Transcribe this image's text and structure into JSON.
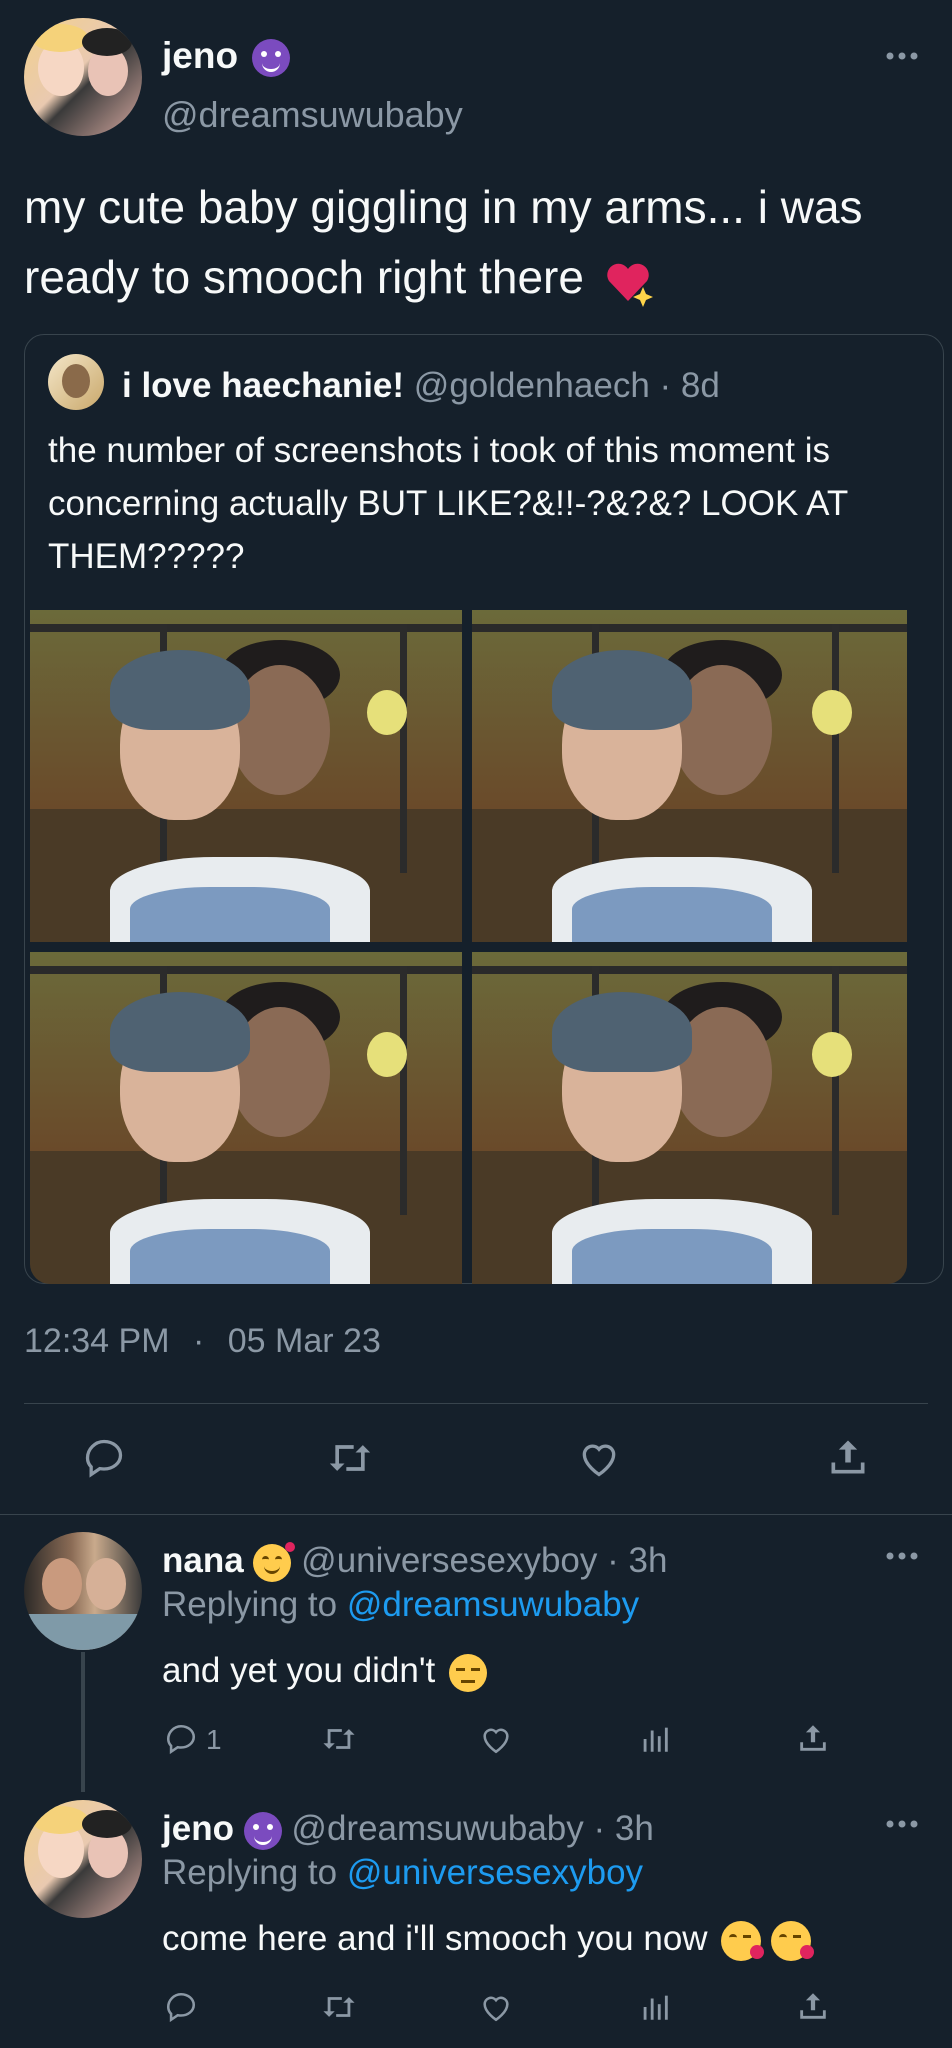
{
  "main_tweet": {
    "display_name": "jeno",
    "handle": "@dreamsuwubaby",
    "text": "my cute baby giggling in my arms... i was ready to smooch right there",
    "time": "12:34 PM",
    "date": "05 Mar 23",
    "more_icon": "more-dots-icon"
  },
  "quoted_tweet": {
    "display_name": "i love haechanie!",
    "handle": "@goldenhaech",
    "age": "· 8d",
    "text": "the number of screenshots i took of this moment is concerning actually BUT LIKE?&!!-?&?&? LOOK AT THEM?????"
  },
  "actions": [
    "reply-icon",
    "retweet-icon",
    "like-icon",
    "share-icon"
  ],
  "replies": [
    {
      "display_name": "nana",
      "handle": "@universesexyboy",
      "age": "· 3h",
      "replying_prefix": "Replying to",
      "replying_to": "@dreamsuwubaby",
      "text": "and yet you didn't",
      "reply_count": "1"
    },
    {
      "display_name": "jeno",
      "handle": "@dreamsuwubaby",
      "age": "· 3h",
      "replying_prefix": "Replying to",
      "replying_to": "@universesexyboy",
      "text": "come here and i'll smooch you now",
      "reply_count": ""
    }
  ],
  "colors": {
    "background": "#15202b",
    "text": "#f7f9f9",
    "muted": "#8b98a5",
    "link": "#1d9bf0",
    "border": "#38444d"
  }
}
